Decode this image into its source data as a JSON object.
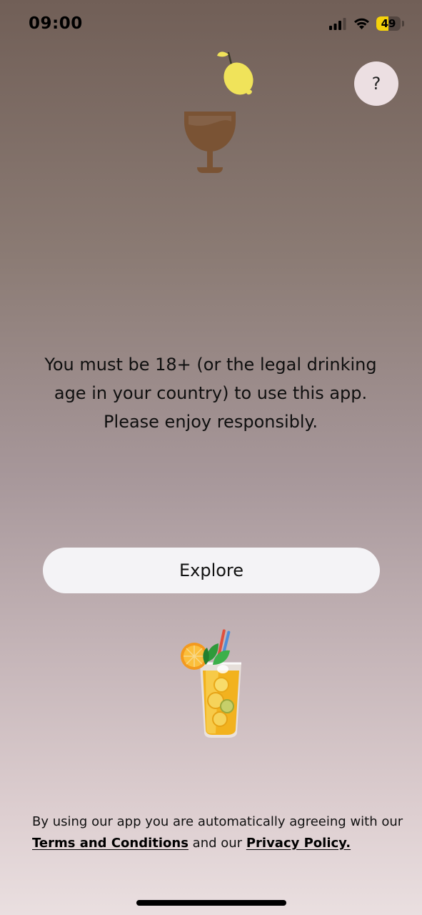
{
  "status_bar": {
    "time": "09:00",
    "battery_level": "49",
    "battery_fraction": 0.49,
    "icons": [
      "signal-icon",
      "wifi-icon",
      "battery-icon"
    ]
  },
  "help_button": {
    "label": "?"
  },
  "logo": {
    "icon": "wine-glass-lemon-icon",
    "colors": {
      "lemon": "#f0e35a",
      "glass": "#7a5334"
    }
  },
  "message": {
    "lines": [
      "You must be 18+ (or the legal drinking",
      "age in your country) to use this app.",
      "Please enjoy responsibly."
    ]
  },
  "explore_button": {
    "label": "Explore"
  },
  "illustration": {
    "icon": "iced-tea-cocktail-icon"
  },
  "legal": {
    "prefix": "By using our app you are automatically agreeing with our",
    "terms_label": "Terms and Conditions",
    "middle": "and our",
    "privacy_label": "Privacy Policy."
  },
  "colors": {
    "background_top": "#715f57",
    "background_bottom": "#eadfe0",
    "button_background": "#f4f3f6",
    "help_button_background": "#ecdfe2",
    "battery_fill": "#f5d20a"
  }
}
